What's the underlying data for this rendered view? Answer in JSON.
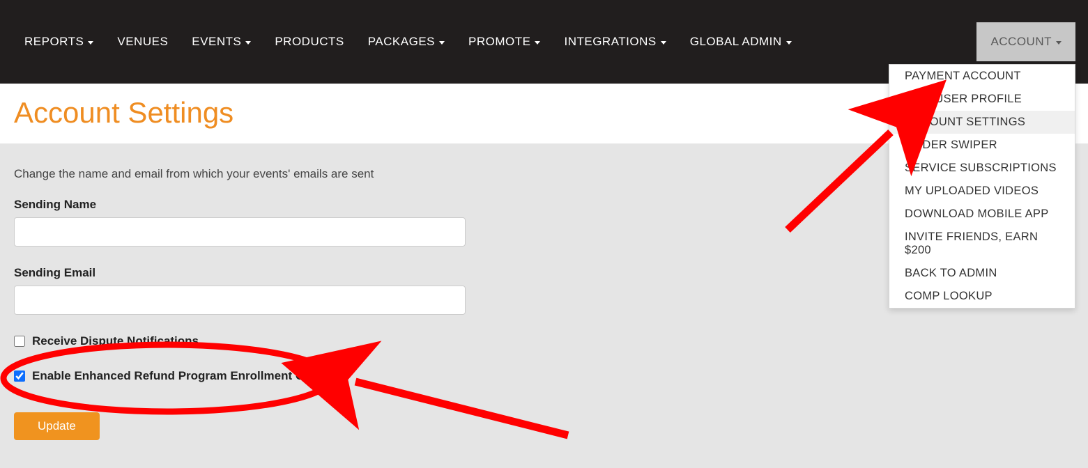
{
  "nav": {
    "items": [
      {
        "label": "REPORTS",
        "dropdown": true
      },
      {
        "label": "VENUES",
        "dropdown": false
      },
      {
        "label": "EVENTS",
        "dropdown": true
      },
      {
        "label": "PRODUCTS",
        "dropdown": false
      },
      {
        "label": "PACKAGES",
        "dropdown": true
      },
      {
        "label": "PROMOTE",
        "dropdown": true
      },
      {
        "label": "INTEGRATIONS",
        "dropdown": true
      },
      {
        "label": "GLOBAL ADMIN",
        "dropdown": true
      }
    ],
    "account_label": "ACCOUNT"
  },
  "dropdown": {
    "items": [
      "PAYMENT ACCOUNT",
      "EDIT USER PROFILE",
      "ACCOUNT SETTINGS",
      "ORDER SWIPER",
      "SERVICE SUBSCRIPTIONS",
      "MY UPLOADED VIDEOS",
      "DOWNLOAD MOBILE APP",
      "INVITE FRIENDS, EARN $200",
      "BACK TO ADMIN",
      "COMP LOOKUP"
    ],
    "active_index": 2
  },
  "page": {
    "title": "Account Settings",
    "helper": "Change the name and email from which your events' emails are sent"
  },
  "form": {
    "sending_name_label": "Sending Name",
    "sending_name_value": "",
    "sending_email_label": "Sending Email",
    "sending_email_value": "",
    "dispute_label": "Receive Dispute Notifications",
    "dispute_checked": false,
    "refund_label": "Enable Enhanced Refund Program Enrollment Option",
    "refund_checked": true,
    "update_label": "Update"
  },
  "annotation_color": "#ff0000"
}
